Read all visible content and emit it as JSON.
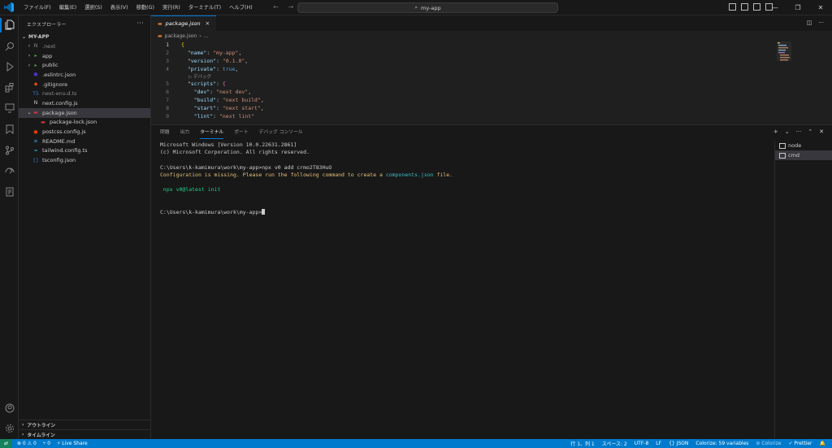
{
  "titlebar": {
    "menu": [
      "ファイル(F)",
      "編集(E)",
      "選択(S)",
      "表示(V)",
      "移動(G)",
      "実行(R)",
      "ターミナル(T)",
      "ヘルプ(H)"
    ],
    "search_text": "my-app",
    "window_controls": [
      "—",
      "❐",
      "✕"
    ]
  },
  "sidebar": {
    "title": "エクスプローラー",
    "root": "MY-APP",
    "items": [
      {
        "label": ".next",
        "icon": "N",
        "icon_color": "#8b8b8b",
        "chevron": "›",
        "indent": 1,
        "dim": true
      },
      {
        "label": "app",
        "icon": "▸",
        "icon_color": "#4caf50",
        "chevron": "›",
        "indent": 1
      },
      {
        "label": "public",
        "icon": "▸",
        "icon_color": "#4caf50",
        "chevron": "›",
        "indent": 1
      },
      {
        "label": ".eslintrc.json",
        "icon": "●",
        "icon_color": "#4b32c3",
        "chevron": "",
        "indent": 1
      },
      {
        "label": ".gitignore",
        "icon": "◆",
        "icon_color": "#e64a19",
        "chevron": "",
        "indent": 1
      },
      {
        "label": "next-env.d.ts",
        "icon": "TS",
        "icon_color": "#3178c6",
        "chevron": "",
        "indent": 1,
        "dim": true
      },
      {
        "label": "next.config.js",
        "icon": "N",
        "icon_color": "#cccccc",
        "chevron": "",
        "indent": 1
      },
      {
        "label": "package.json",
        "icon": "▬",
        "icon_color": "#cb3837",
        "chevron": "⌄",
        "indent": 1,
        "selected": true
      },
      {
        "label": "package-lock.json",
        "icon": "▬",
        "icon_color": "#cb3837",
        "chevron": "",
        "indent": 2
      },
      {
        "label": "postcss.config.js",
        "icon": "●",
        "icon_color": "#dd3a0a",
        "chevron": "",
        "indent": 1
      },
      {
        "label": "README.md",
        "icon": "≡",
        "icon_color": "#42a5f5",
        "chevron": "",
        "indent": 1
      },
      {
        "label": "tailwind.config.ts",
        "icon": "≈",
        "icon_color": "#38bdf8",
        "chevron": "",
        "indent": 1
      },
      {
        "label": "tsconfig.json",
        "icon": "{}",
        "icon_color": "#3178c6",
        "chevron": "",
        "indent": 1
      }
    ],
    "bottom_panels": [
      "アウトライン",
      "タイムライン"
    ]
  },
  "editor": {
    "tab_label": "package.json",
    "breadcrumb": [
      "package.json",
      "..."
    ],
    "codelens": "▷ デバッグ",
    "lines": [
      {
        "n": "1",
        "html_parts": [
          [
            "br",
            "{"
          ]
        ]
      },
      {
        "n": "2",
        "html_parts": [
          [
            "p",
            "  "
          ],
          [
            "k",
            "\"name\""
          ],
          [
            "p",
            ": "
          ],
          [
            "s",
            "\"my-app\""
          ],
          [
            "p",
            ","
          ]
        ]
      },
      {
        "n": "3",
        "html_parts": [
          [
            "p",
            "  "
          ],
          [
            "k",
            "\"version\""
          ],
          [
            "p",
            ": "
          ],
          [
            "s",
            "\"0.1.0\""
          ],
          [
            "p",
            ","
          ]
        ]
      },
      {
        "n": "4",
        "html_parts": [
          [
            "p",
            "  "
          ],
          [
            "k",
            "\"private\""
          ],
          [
            "p",
            ": "
          ],
          [
            "b",
            "true"
          ],
          [
            "p",
            ","
          ]
        ]
      },
      {
        "n": "5",
        "html_parts": [
          [
            "p",
            "  "
          ],
          [
            "k",
            "\"scripts\""
          ],
          [
            "p",
            ": "
          ],
          [
            "br2",
            "{"
          ]
        ]
      },
      {
        "n": "6",
        "html_parts": [
          [
            "p",
            "    "
          ],
          [
            "k",
            "\"dev\""
          ],
          [
            "p",
            ": "
          ],
          [
            "s",
            "\"next dev\""
          ],
          [
            "p",
            ","
          ]
        ]
      },
      {
        "n": "7",
        "html_parts": [
          [
            "p",
            "    "
          ],
          [
            "k",
            "\"build\""
          ],
          [
            "p",
            ": "
          ],
          [
            "s",
            "\"next build\""
          ],
          [
            "p",
            ","
          ]
        ]
      },
      {
        "n": "8",
        "html_parts": [
          [
            "p",
            "    "
          ],
          [
            "k",
            "\"start\""
          ],
          [
            "p",
            ": "
          ],
          [
            "s",
            "\"next start\""
          ],
          [
            "p",
            ","
          ]
        ]
      },
      {
        "n": "9",
        "html_parts": [
          [
            "p",
            "    "
          ],
          [
            "k",
            "\"lint\""
          ],
          [
            "p",
            ": "
          ],
          [
            "s",
            "\"next lint\""
          ]
        ]
      }
    ]
  },
  "panel": {
    "tabs": [
      "問題",
      "出力",
      "ターミナル",
      "ポート",
      "デバッグ コンソール"
    ],
    "active_tab": 2,
    "actions": [
      "+",
      "⌄",
      "···",
      "⌃",
      "✕"
    ],
    "terminal_lines": [
      {
        "text": "Microsoft Windows [Version 10.0.22631.2861]",
        "cls": ""
      },
      {
        "text": "(c) Microsoft Corporation. All rights reserved.",
        "cls": ""
      },
      {
        "text": "",
        "cls": ""
      },
      {
        "text": "C:\\Users\\k-kamimura\\work\\my-app>npx v0 add crmo2T83HuO",
        "cls": ""
      },
      {
        "text": "Configuration is missing. Please run the following command to create a ",
        "cls": "warn",
        "cyan": "components.json",
        "after": " file."
      },
      {
        "text": "",
        "cls": ""
      },
      {
        "text": " npx v0@latest init",
        "cls": "green"
      },
      {
        "text": "",
        "cls": ""
      },
      {
        "text": "",
        "cls": ""
      },
      {
        "text": "C:\\Users\\k-kamimura\\work\\my-app>",
        "cls": "",
        "cursor": true
      }
    ],
    "terminals": [
      {
        "label": "node",
        "active": false
      },
      {
        "label": "cmd",
        "active": true
      }
    ]
  },
  "statusbar": {
    "remote": "⇄",
    "left": [
      "⊗ 0  ⚠ 0",
      "⑂ 0",
      "⚡ Live Share"
    ],
    "right": [
      "行 1、列 1",
      "スペース: 2",
      "UTF-8",
      "LF",
      "{} JSON",
      "Colorize: 59 variables",
      "⊘ Colorize",
      "✓ Prettier",
      "🔔"
    ]
  }
}
